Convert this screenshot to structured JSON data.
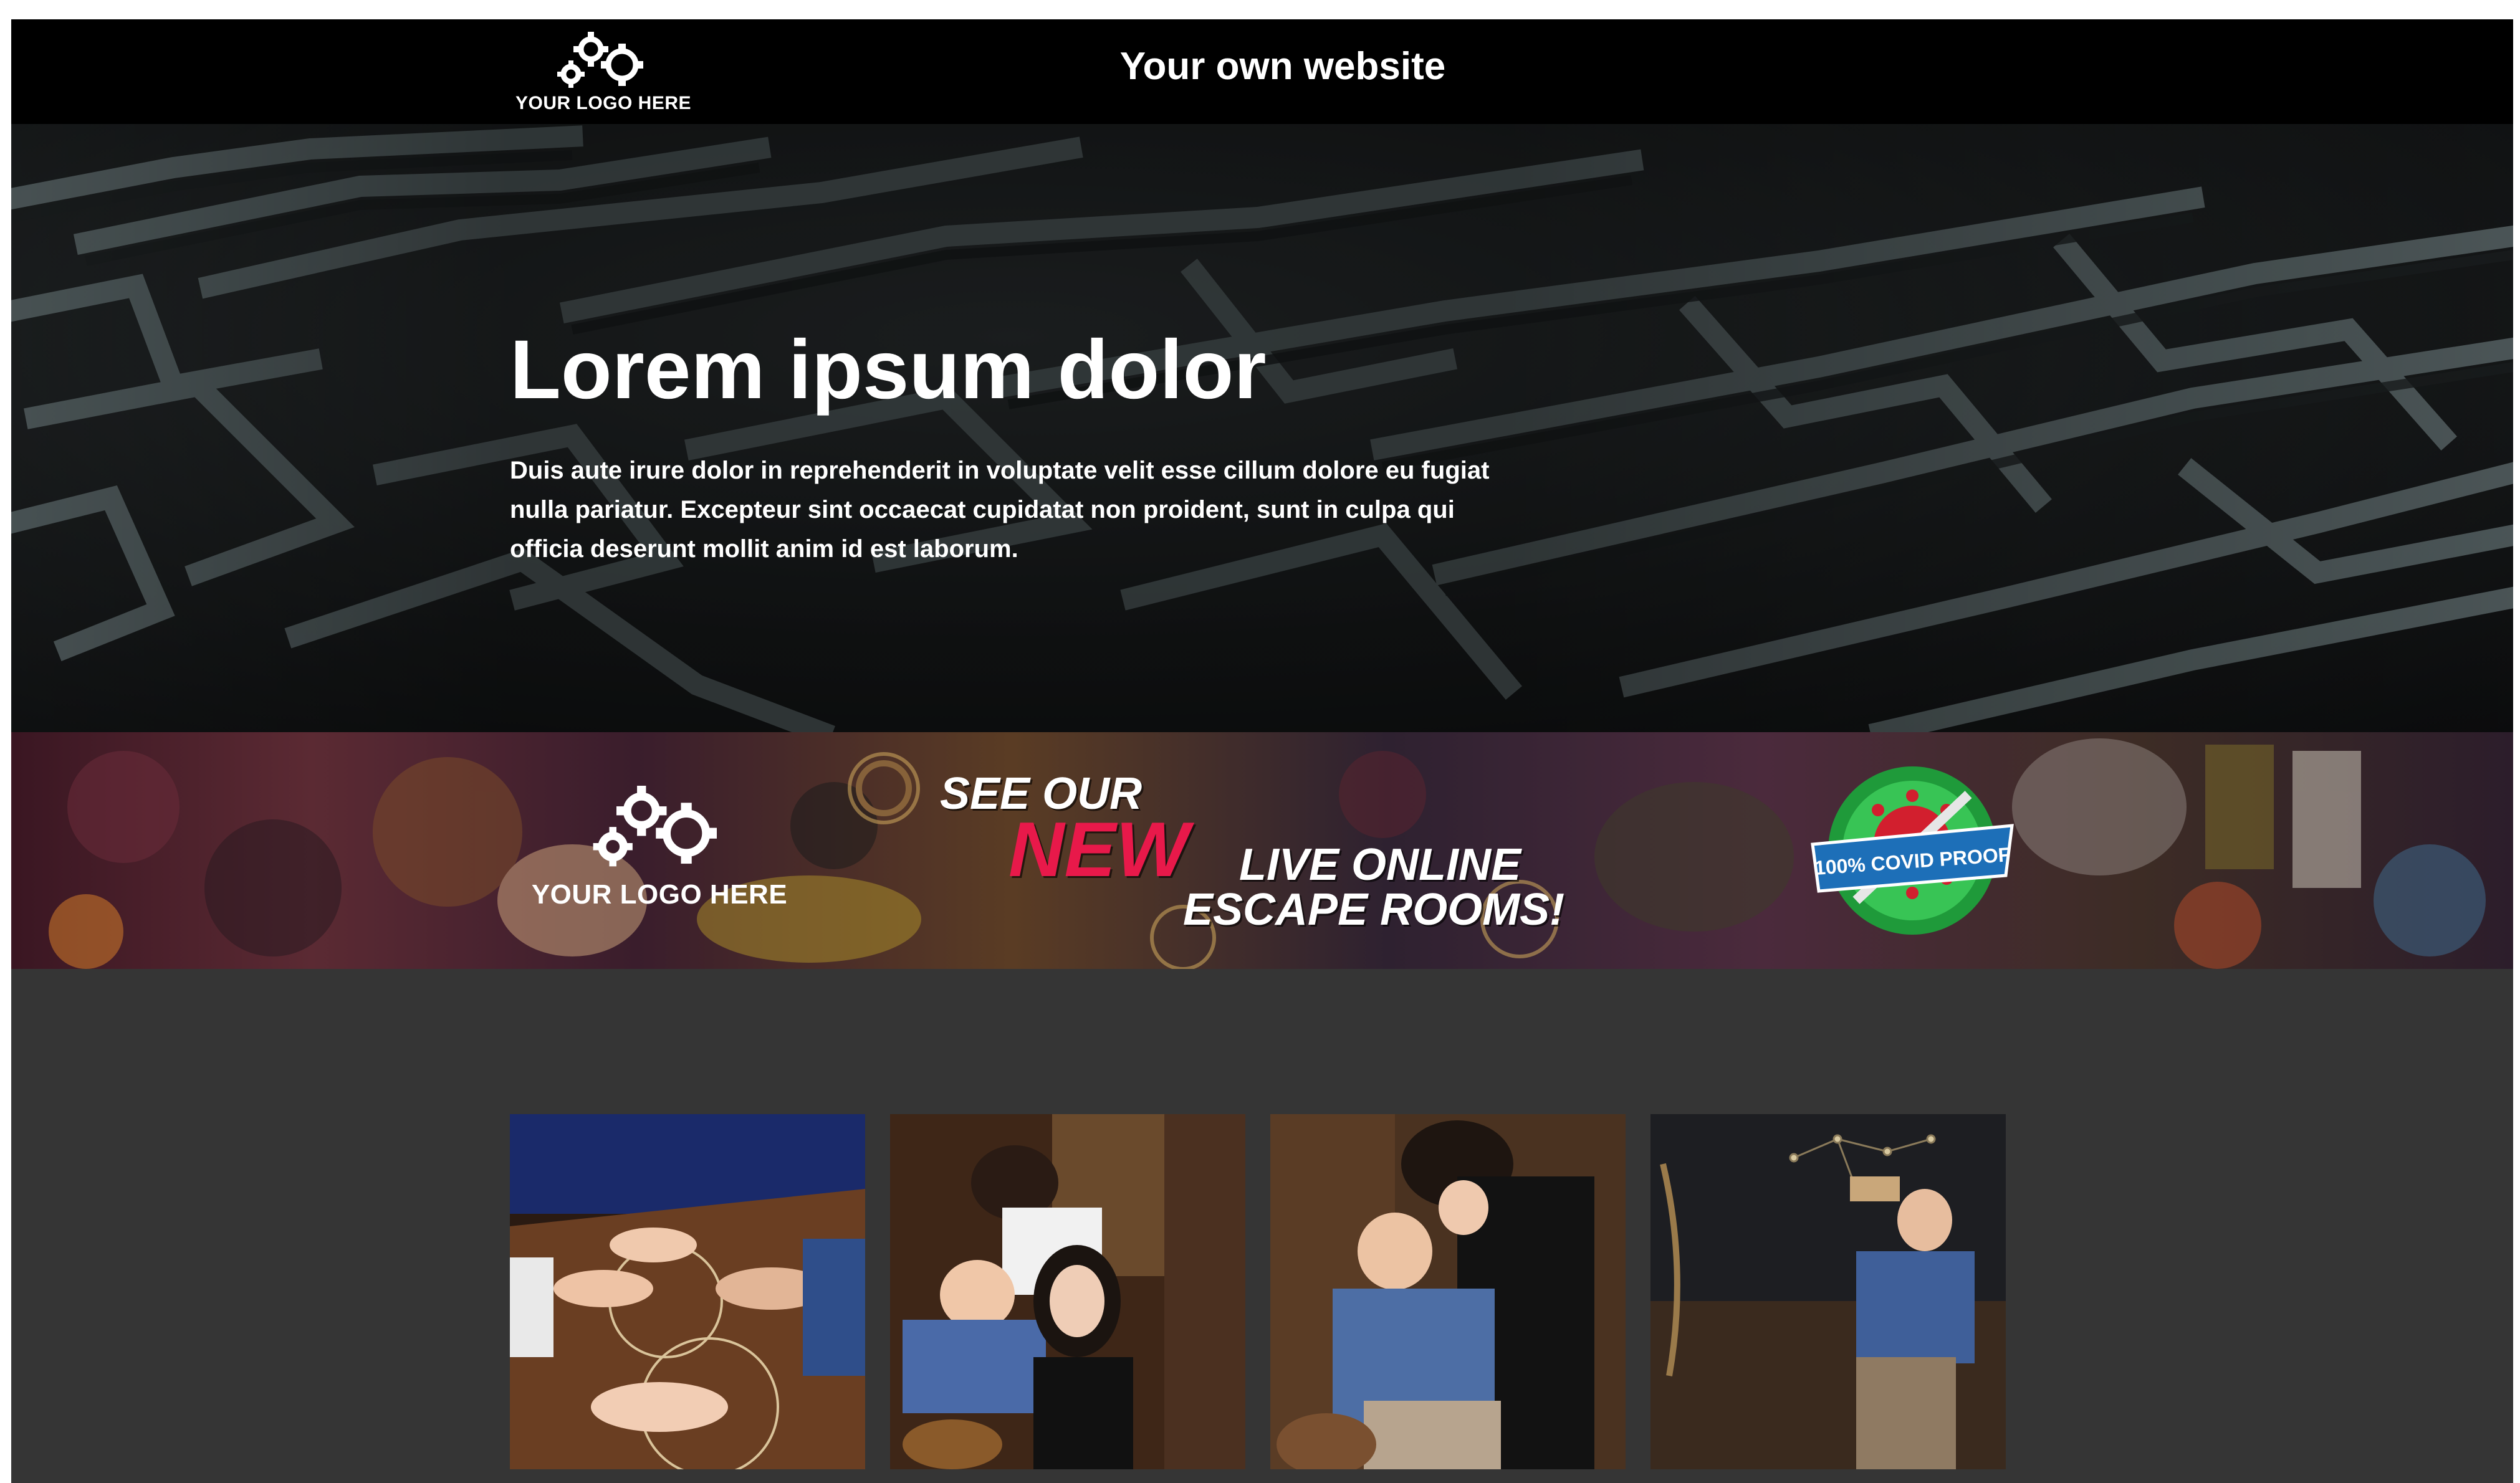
{
  "header": {
    "logo_text": "YOUR LOGO HERE",
    "title": "Your own website"
  },
  "hero": {
    "heading": "Lorem ipsum dolor",
    "body": "Duis aute irure dolor in reprehenderit in voluptate velit esse cillum dolore eu fugiat nulla pariatur. Excepteur sint occaecat cupidatat non proident, sunt in culpa qui officia deserunt mollit anim id est laborum."
  },
  "banner": {
    "logo_text": "YOUR LOGO HERE",
    "line1": "SEE OUR",
    "line2": "NEW",
    "line3": "LIVE ONLINE",
    "line4": "ESCAPE ROOMS!",
    "badge": "100% COVID PROOF"
  },
  "gallery": {
    "photos": [
      {
        "subject": "ouija-board-hands"
      },
      {
        "subject": "three-players-searching"
      },
      {
        "subject": "players-examining-object"
      },
      {
        "subject": "player-reading-scroll"
      }
    ]
  },
  "colors": {
    "header_bg": "#000000",
    "page_bg": "#353535",
    "accent": "#e8194a"
  }
}
